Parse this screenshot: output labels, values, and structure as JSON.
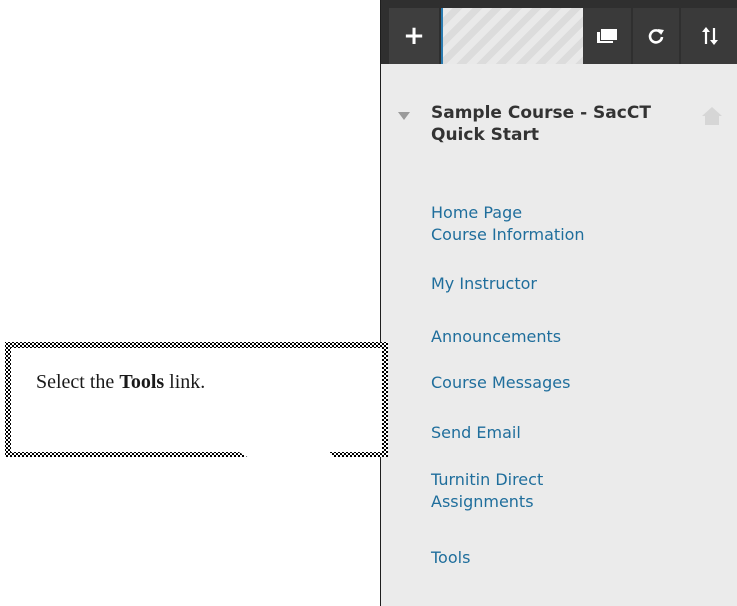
{
  "toolbar": {
    "plus_label": "+",
    "icons": [
      "window-icon",
      "refresh-icon",
      "sort-icon"
    ]
  },
  "course": {
    "title": "Sample Course - SacCT Quick Start"
  },
  "menu": {
    "items": [
      {
        "label": "Home Page"
      },
      {
        "label": "Course Information"
      },
      {
        "label": "My Instructor"
      },
      {
        "label": "Announcements"
      },
      {
        "label": "Course Messages"
      },
      {
        "label": "Send Email"
      },
      {
        "label": "Turnitin Direct Assignments"
      },
      {
        "label": "Tools"
      }
    ]
  },
  "callout": {
    "prefix": "Select the ",
    "bold": "Tools",
    "suffix": " link."
  },
  "colors": {
    "link": "#1f6e9c",
    "panel_bg": "#ebebeb",
    "toolbar_bg": "#2f2f2f",
    "accent": "#2a7bb0"
  }
}
